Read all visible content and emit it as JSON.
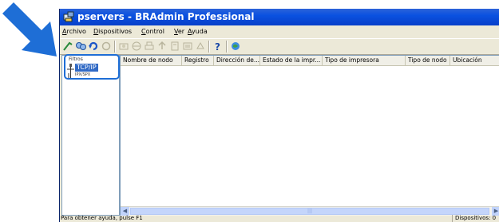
{
  "window": {
    "title": "pservers - BRAdmin Professional"
  },
  "menu": [
    "Archivo",
    "Dispositivos",
    "Control",
    "Ver",
    "Ayuda"
  ],
  "tree": {
    "root": "Filtros",
    "items": [
      "TCP/IP",
      "IPX/SPX"
    ]
  },
  "columns": [
    "Nombre de nodo",
    "Registro",
    "Dirección de...",
    "Estado de la impr...",
    "Tipo de impresora",
    "Tipo de nodo",
    "Ubicación"
  ],
  "statusbar": {
    "hint": "Para obtener ayuda, pulse F1",
    "devices": "Dispositivos: 0"
  },
  "colors": {
    "accent": "#1e6ed6",
    "titlebar": "#0a51e0"
  },
  "icons": {
    "pointer": "arrow-pointer-icon",
    "app": "app-icon",
    "tcp": "network-icon"
  }
}
